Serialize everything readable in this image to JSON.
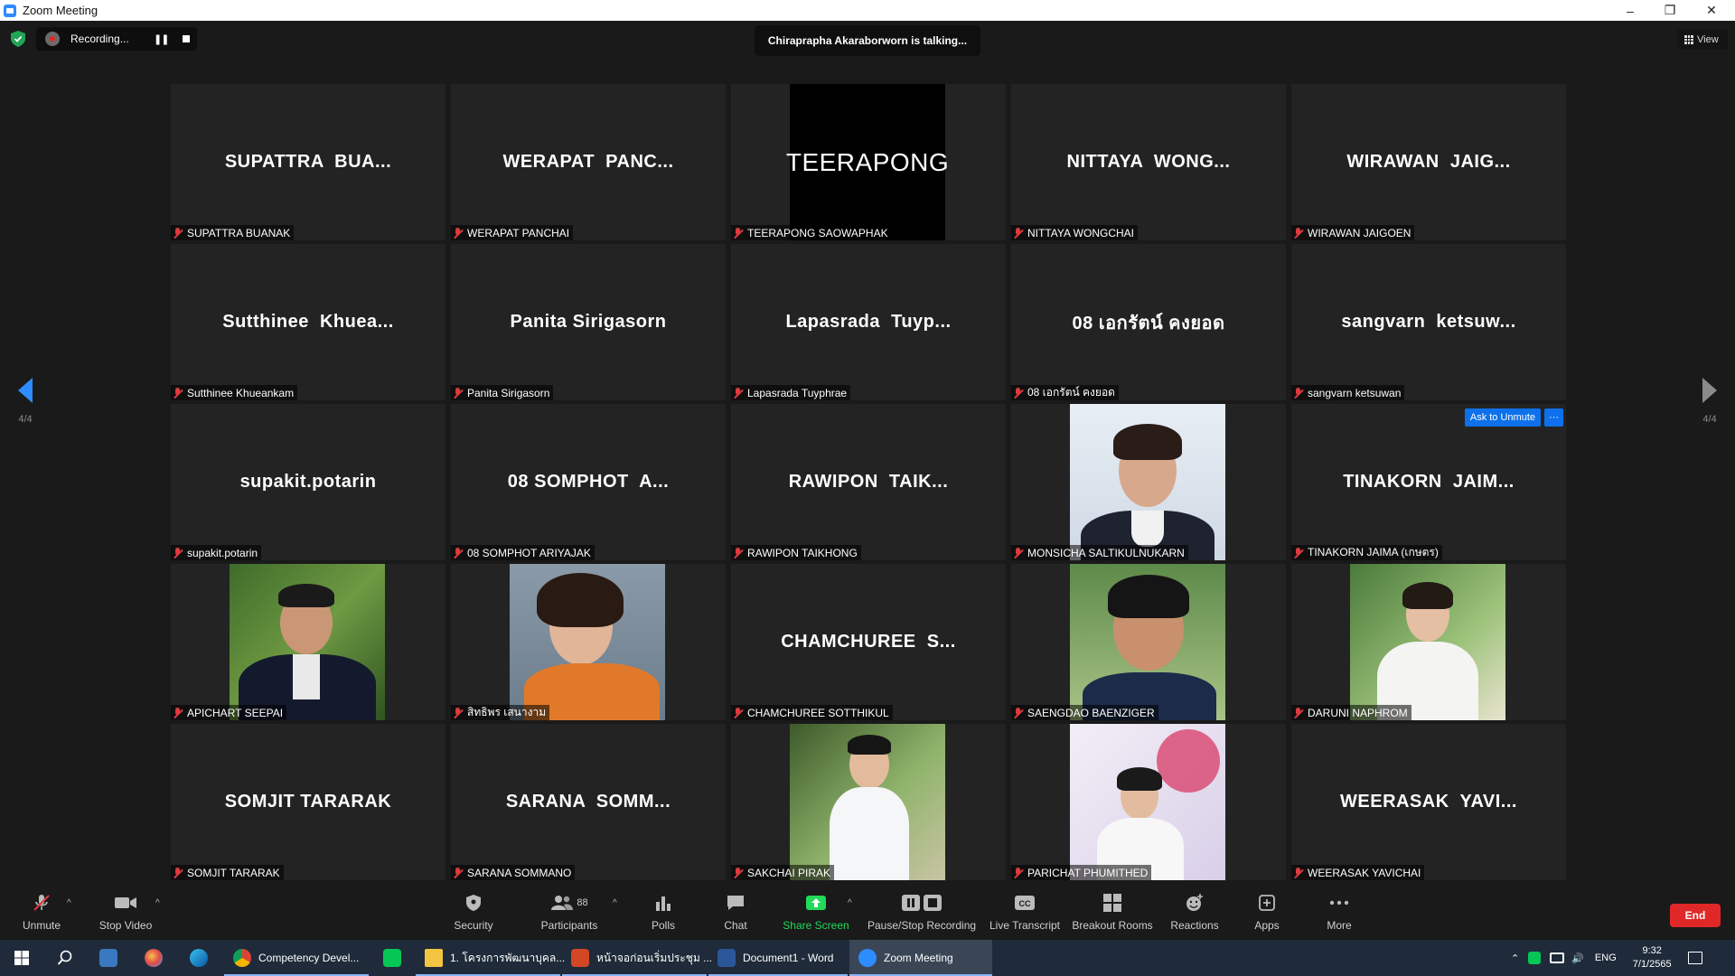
{
  "window": {
    "title": "Zoom Meeting"
  },
  "top": {
    "recording_text": "Recording...",
    "talking_text": "Chiraprapha Akaraborworn is talking...",
    "view_label": "View",
    "page_indicator": "4/4"
  },
  "colors": {
    "accent": "#0e71eb",
    "muted_red": "#e0393e",
    "end_red": "#e02828",
    "share_green": "#23d959"
  },
  "tiles": [
    {
      "big": "SUPATTRA  BUA...",
      "label": "SUPATTRA BUANAK"
    },
    {
      "big": "WERAPAT  PANC...",
      "label": "WERAPAT PANCHAI"
    },
    {
      "big": "TEERAPONG",
      "label": "TEERAPONG SAOWAPHAK"
    },
    {
      "big": "NITTAYA  WONG...",
      "label": "NITTAYA WONGCHAI"
    },
    {
      "big": "WIRAWAN  JAIG...",
      "label": "WIRAWAN JAIGOEN"
    },
    {
      "big": "Sutthinee  Khuea...",
      "label": "Sutthinee Khueankam"
    },
    {
      "big": "Panita Sirigasorn",
      "label": "Panita Sirigasorn"
    },
    {
      "big": "Lapasrada  Tuyp...",
      "label": "Lapasrada  Tuyphrae"
    },
    {
      "big": "08 เอกรัตน์ คงยอด",
      "label": "08 เอกรัตน์ คงยอด"
    },
    {
      "big": "sangvarn  ketsuw...",
      "label": "sangvarn ketsuwan"
    },
    {
      "big": "supakit.potarin",
      "label": "supakit.potarin"
    },
    {
      "big": "08 SOMPHOT  A...",
      "label": "08 SOMPHOT ARIYAJAK"
    },
    {
      "big": "RAWIPON  TAIK...",
      "label": "RAWIPON TAIKHONG"
    },
    {
      "big": "",
      "label": "MONSICHA SALTIKULNUKARN"
    },
    {
      "big": "TINAKORN  JAIM...",
      "label": "TINAKORN JAIMA (เกษตร)"
    },
    {
      "big": "",
      "label": "APICHART SEEPAI"
    },
    {
      "big": "",
      "label": "สิทธิพร เสนางาม"
    },
    {
      "big": "CHAMCHUREE  S...",
      "label": "CHAMCHUREE SOTTHIKUL"
    },
    {
      "big": "",
      "label": "SAENGDAO BAENZIGER"
    },
    {
      "big": "",
      "label": "DARUNI NAPHROM"
    },
    {
      "big": "SOMJIT TARARAK",
      "label": "SOMJIT TARARAK"
    },
    {
      "big": "SARANA  SOMM...",
      "label": "SARANA SOMMANO"
    },
    {
      "big": "",
      "label": "SAKCHAI PIRAK"
    },
    {
      "big": "",
      "label": "PARICHAT PHUMITHED"
    },
    {
      "big": "WEERASAK  YAVI...",
      "label": "WEERASAK YAVICHAI"
    }
  ],
  "tile_actions": {
    "ask_unmute": "Ask to Unmute",
    "more": "···"
  },
  "toolbar": {
    "unmute": "Unmute",
    "stop_video": "Stop Video",
    "security": "Security",
    "participants": "Participants",
    "participants_count": "88",
    "polls": "Polls",
    "chat": "Chat",
    "share_screen": "Share Screen",
    "pause_stop_recording": "Pause/Stop Recording",
    "live_transcript": "Live Transcript",
    "breakout_rooms": "Breakout Rooms",
    "reactions": "Reactions",
    "apps": "Apps",
    "more": "More",
    "end": "End"
  },
  "taskbar": {
    "chrome": "Competency Devel...",
    "folder": "1. โครงการพัฒนาบุคล...",
    "powerpoint": "หน้าจอก่อนเริ่มประชุม ...",
    "word": "Document1 - Word",
    "zoom": "Zoom Meeting",
    "lang": "ENG",
    "time": "9:32",
    "date": "7/1/2565"
  }
}
